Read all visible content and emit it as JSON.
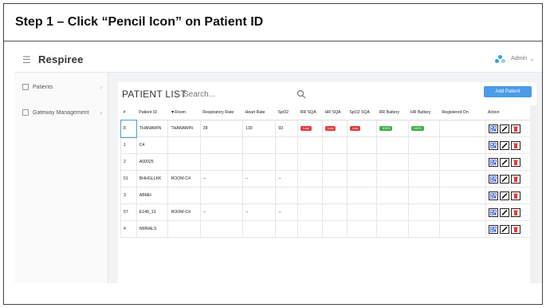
{
  "step": {
    "title": "Step 1 – Click “Pencil Icon” on Patient ID"
  },
  "app": {
    "name": "Respiree",
    "user": "Admin"
  },
  "sidebar": {
    "items": [
      {
        "label": "Patients"
      },
      {
        "label": "Gateway Management"
      }
    ]
  },
  "patient_list": {
    "title": "PATIENT LIST",
    "search_placeholder": "Search...",
    "add_button": "Add Patient",
    "columns": [
      "#",
      "Patient ID",
      "▼Room",
      "Respiratory Rate",
      "Heart Rate",
      "SpO2",
      "RR SQA",
      "HR SQA",
      "SpO2 SQA",
      "RR Battery",
      "HR Battery",
      "Registered On",
      "Action"
    ],
    "rows": [
      [
        "8",
        "THANAWIN",
        "THANAWIN",
        "28",
        "130",
        "93",
        "Low",
        "Low",
        "Low",
        "100%",
        "100%",
        "",
        ""
      ],
      [
        "1",
        "C4",
        "",
        "",
        "",
        "",
        "",
        "",
        "",
        "",
        "",
        "",
        ""
      ],
      [
        "2",
        "A00025",
        "",
        "",
        "",
        "",
        "",
        "",
        "",
        "",
        "",
        "",
        ""
      ],
      [
        "51",
        "BHHGLLKK",
        "ROOM-C4",
        "--",
        "--",
        "--",
        "",
        "",
        "",
        "",
        "",
        "",
        ""
      ],
      [
        "3",
        "ABMH",
        "",
        "",
        "",
        "",
        "",
        "",
        "",
        "",
        "",
        "",
        ""
      ],
      [
        "57",
        "E148_13",
        "ROOM-C4",
        "--",
        "--",
        "--",
        "",
        "",
        "",
        "",
        "",
        "",
        ""
      ],
      [
        "4",
        "NMNALS",
        "",
        "",
        "",
        "",
        "",
        "",
        "",
        "",
        "",
        "",
        ""
      ]
    ]
  },
  "icons": {
    "action": [
      "qr-icon",
      "pencil-icon",
      "trash-icon"
    ],
    "accent": "#4c9be8",
    "danger": "#e03c3c",
    "ok": "#3cb043"
  }
}
